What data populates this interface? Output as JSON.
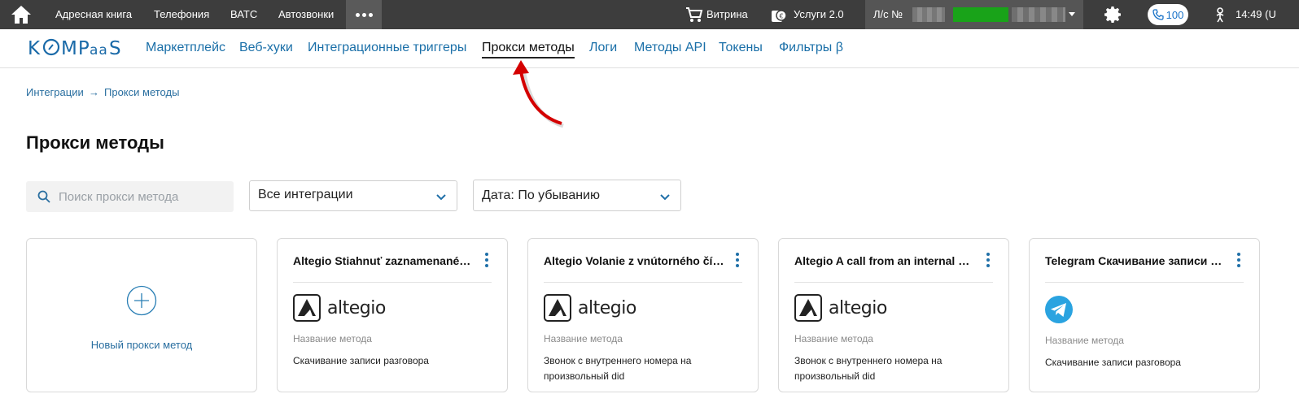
{
  "topbar": {
    "nav": [
      "Адресная книга",
      "Телефония",
      "ВАТС",
      "Автозвонки"
    ],
    "showcase_label": "Витрина",
    "services_label": "Услуги 2.0",
    "account_label": "Л/с №",
    "calls_count": "100",
    "time": "14:49 (U"
  },
  "logo": "KOMPaaS",
  "tabs": [
    {
      "label": "Маркетплейс"
    },
    {
      "label": "Веб-хуки"
    },
    {
      "label": "Интеграционные триггеры"
    },
    {
      "label": "Прокси методы",
      "active": true
    },
    {
      "label": "Логи"
    },
    {
      "label": "Методы API"
    },
    {
      "label": "Токены"
    },
    {
      "label": "Фильтры β"
    }
  ],
  "breadcrumb": {
    "root": "Интеграции",
    "current": "Прокси методы"
  },
  "page_title": "Прокси методы",
  "search": {
    "placeholder": "Поиск прокси метода",
    "value": ""
  },
  "filters": {
    "integration": "Все интеграции",
    "sort": "Дата: По убыванию"
  },
  "new_card_label": "Новый прокси метод",
  "cards": [
    {
      "title": "Altegio Stiahnuť zaznamenané hovory",
      "brand": "altegio",
      "method_label": "Название метода",
      "method": "Скачивание записи разговора"
    },
    {
      "title": "Altegio Volanie z vnútorného čísla",
      "brand": "altegio",
      "method_label": "Название метода",
      "method": "Звонок с внутреннего номера на произвольный did"
    },
    {
      "title": "Altegio A call from an internal number",
      "brand": "altegio",
      "method_label": "Название метода",
      "method": "Звонок с внутреннего номера на произвольный did"
    },
    {
      "title": "Telegram Скачивание записи разговора",
      "brand": "telegram",
      "method_label": "Название метода",
      "method": "Скачивание записи разговора"
    }
  ],
  "colors": {
    "topbar": "#3d3d3d",
    "link": "#1a6fa8",
    "accent_arrow": "#d40000",
    "telegram": "#2aa3e0"
  }
}
